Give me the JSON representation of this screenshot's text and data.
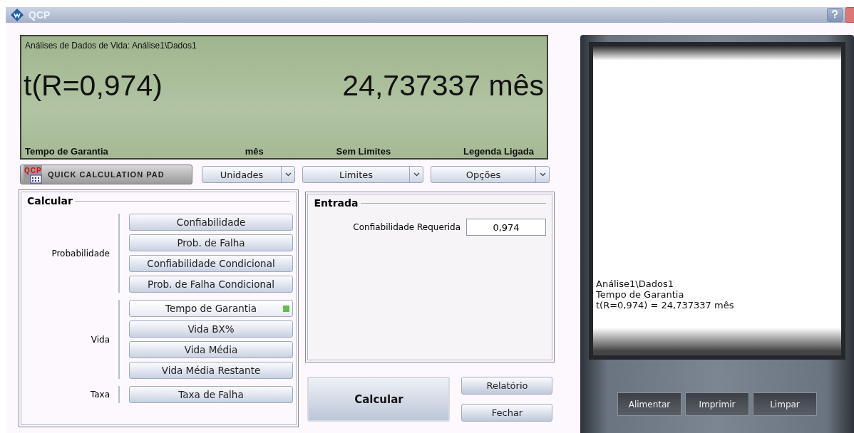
{
  "window": {
    "title": "QCP"
  },
  "display": {
    "header": "Análises de Dados de Vida: Análise1\\Dados1",
    "result_label": "t(R=0,974)",
    "result_value": "24,737337 mês",
    "footer": [
      "Tempo de Garantia",
      "mês",
      "Sem Limites",
      "Legenda Ligada"
    ]
  },
  "toolbar": {
    "pad_button": {
      "badge": "QCP",
      "label": "QUICK CALCULATION PAD"
    },
    "dropdowns": [
      "Unidades",
      "Limites",
      "Opções"
    ]
  },
  "calculate": {
    "title": "Calcular",
    "groups": [
      {
        "label": "Probabilidade",
        "buttons": [
          {
            "label": "Confiabilidade",
            "selected": false
          },
          {
            "label": "Prob. de Falha",
            "selected": false
          },
          {
            "label": "Confiabilidade Condicional",
            "selected": false
          },
          {
            "label": "Prob. de Falha Condicional",
            "selected": false
          }
        ]
      },
      {
        "label": "Vida",
        "buttons": [
          {
            "label": "Tempo de Garantia",
            "selected": true
          },
          {
            "label": "Vida BX%",
            "selected": false
          },
          {
            "label": "Vida Média",
            "selected": false
          },
          {
            "label": "Vida Média Restante",
            "selected": false
          }
        ]
      },
      {
        "label": "Taxa",
        "buttons": [
          {
            "label": "Taxa de Falha",
            "selected": false
          }
        ]
      }
    ]
  },
  "input": {
    "title": "Entrada",
    "fields": [
      {
        "label": "Confiabilidade Requerida",
        "value": "0,974"
      }
    ]
  },
  "actions": {
    "primary": "Calcular",
    "secondary": [
      "Relatório",
      "Fechar"
    ]
  },
  "printer": {
    "lines": [
      "Análise1\\Dados1",
      "Tempo de Garantia",
      "t(R=0,974) = 24,737337 mês"
    ],
    "buttons": [
      "Alimentar",
      "Imprimir",
      "Limpar"
    ]
  }
}
